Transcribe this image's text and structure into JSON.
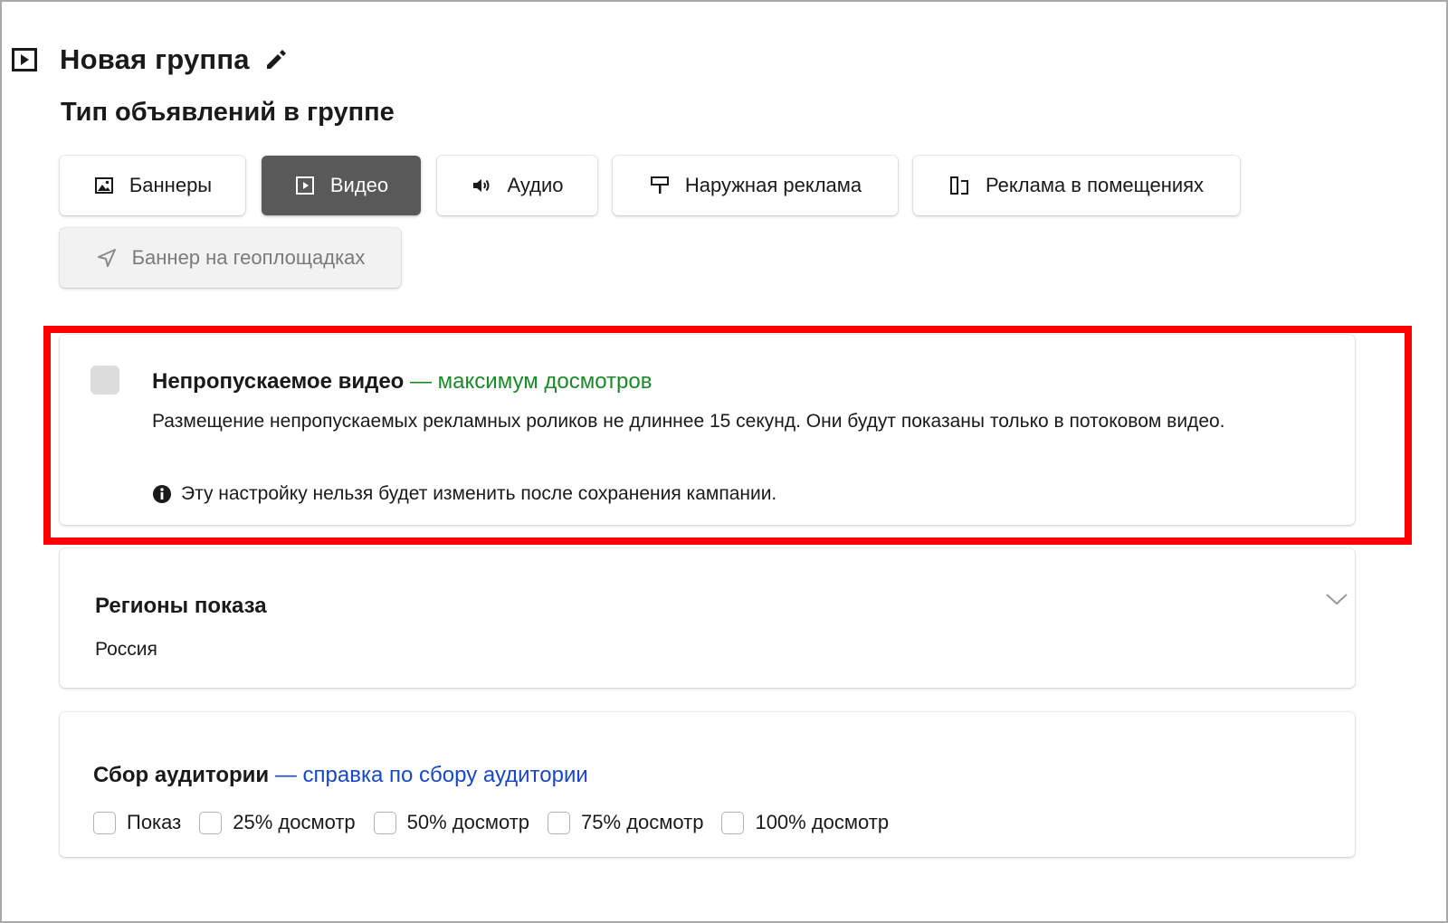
{
  "header": {
    "icon": "video-play-icon",
    "title": "Новая группа",
    "edit_icon": "pencil-icon"
  },
  "section_title": "Тип объявлений в группе",
  "ad_types": [
    {
      "label": "Баннеры",
      "icon": "image-icon",
      "state": "normal"
    },
    {
      "label": "Видео",
      "icon": "video-play-icon",
      "state": "selected"
    },
    {
      "label": "Аудио",
      "icon": "speaker-icon",
      "state": "normal"
    },
    {
      "label": "Наружная реклама",
      "icon": "billboard-icon",
      "state": "normal"
    },
    {
      "label": "Реклама в помещениях",
      "icon": "indoor-screen-icon",
      "state": "normal"
    },
    {
      "label": "Баннер на геоплощадках",
      "icon": "navigation-arrow-icon",
      "state": "disabled"
    }
  ],
  "nonskip": {
    "checked": false,
    "title": "Непропускаемое видео",
    "tagline": " — максимум досмотров",
    "description": "Размещение непропускаемых рекламных роликов не длиннее 15 секунд. Они будут показаны только в потоковом видео.",
    "note": "Эту настройку нельзя будет изменить после сохранения кампании."
  },
  "regions": {
    "title": "Регионы показа",
    "value": "Россия"
  },
  "audience": {
    "title": "Сбор аудитории",
    "help_link": " — справка по сбору аудитории",
    "options": [
      {
        "label": "Показ",
        "checked": false
      },
      {
        "label": "25% досмотр",
        "checked": false
      },
      {
        "label": "50% досмотр",
        "checked": false
      },
      {
        "label": "75% досмотр",
        "checked": false
      },
      {
        "label": "100% досмотр",
        "checked": false
      }
    ]
  },
  "colors": {
    "selected_button": "#595959",
    "highlight_border": "#ff0000",
    "tagline_green": "#1a8a28",
    "link_blue": "#1848c8"
  }
}
